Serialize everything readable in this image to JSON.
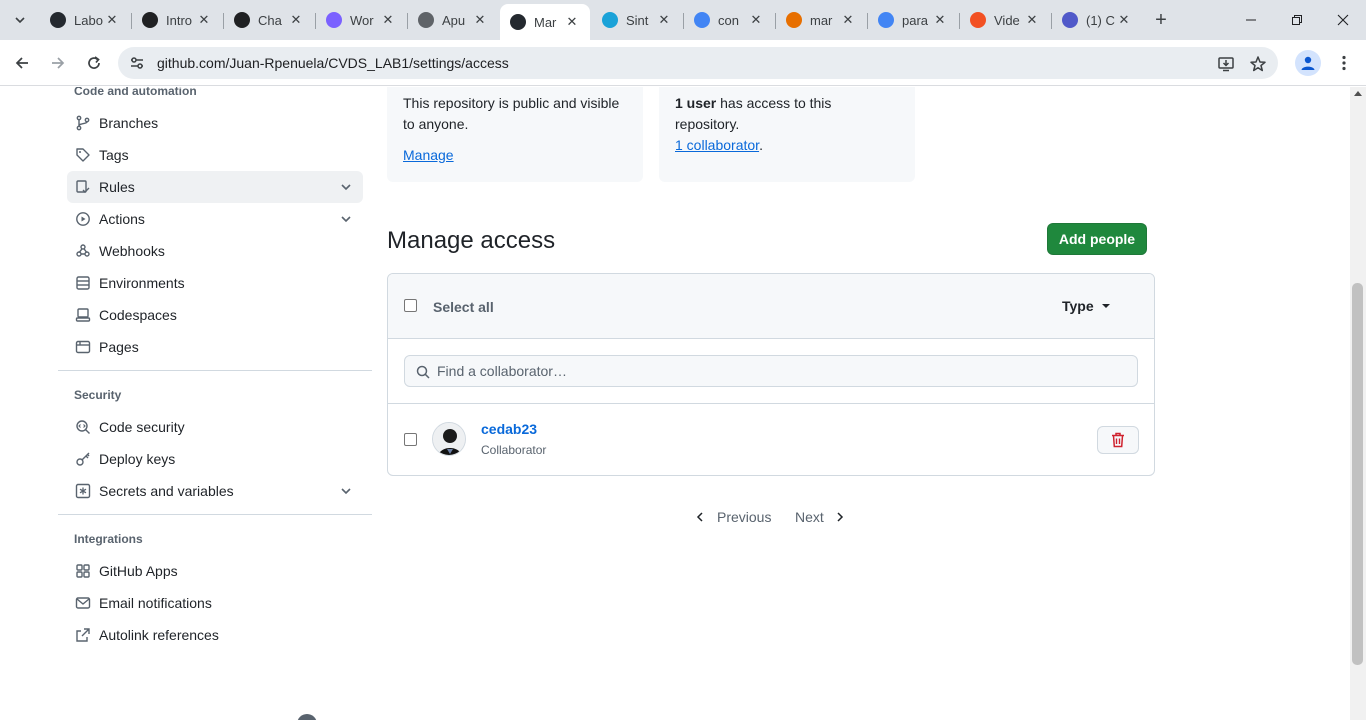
{
  "browser": {
    "tabs": [
      {
        "title": "Labo",
        "favicon": "github-icon",
        "color": "#24292f"
      },
      {
        "title": "Intro",
        "favicon": "openai-icon",
        "color": "#202123"
      },
      {
        "title": "Cha",
        "favicon": "openai-icon",
        "color": "#202123"
      },
      {
        "title": "Wor",
        "favicon": "copilot-icon",
        "color": "#7b61ff"
      },
      {
        "title": "Apu",
        "favicon": "globe-icon",
        "color": "#5f6368"
      },
      {
        "title": "Mar",
        "favicon": "github-icon",
        "color": "#24292f",
        "active": true
      },
      {
        "title": "Sint",
        "favicon": "m-icon",
        "color": "#1aa2d8"
      },
      {
        "title": "con",
        "favicon": "google-icon",
        "color": "#4285f4"
      },
      {
        "title": "mar",
        "favicon": "java-icon",
        "color": "#e76f00"
      },
      {
        "title": "para",
        "favicon": "google-icon",
        "color": "#4285f4"
      },
      {
        "title": "Vide",
        "favicon": "microsoft-icon",
        "color": "#f25022"
      },
      {
        "title": "(1) C",
        "favicon": "teams-icon",
        "color": "#5059c9"
      }
    ],
    "url": "github.com/Juan-Rpenuela/CVDS_LAB1/settings/access"
  },
  "sidebar": {
    "code_heading": "Code and automation",
    "code_items": [
      {
        "label": "Branches",
        "icon": "branch-icon"
      },
      {
        "label": "Tags",
        "icon": "tag-icon"
      },
      {
        "label": "Rules",
        "icon": "rules-icon",
        "expandable": true,
        "active": true
      },
      {
        "label": "Actions",
        "icon": "play-icon",
        "expandable": true
      },
      {
        "label": "Webhooks",
        "icon": "webhook-icon"
      },
      {
        "label": "Environments",
        "icon": "server-icon"
      },
      {
        "label": "Codespaces",
        "icon": "codespaces-icon"
      },
      {
        "label": "Pages",
        "icon": "browser-icon"
      }
    ],
    "security_heading": "Security",
    "security_items": [
      {
        "label": "Code security",
        "icon": "codescan-icon"
      },
      {
        "label": "Deploy keys",
        "icon": "key-icon"
      },
      {
        "label": "Secrets and variables",
        "icon": "asterisk-icon",
        "expandable": true
      }
    ],
    "integrations_heading": "Integrations",
    "integration_items": [
      {
        "label": "GitHub Apps",
        "icon": "apps-icon"
      },
      {
        "label": "Email notifications",
        "icon": "mail-icon"
      },
      {
        "label": "Autolink references",
        "icon": "link-external-icon"
      }
    ]
  },
  "visibility_card": {
    "text": "This repository is public and visible to anyone.",
    "manage_link": "Manage"
  },
  "access_card": {
    "count_bold": "1 user",
    "count_rest": " has access to this repository.",
    "collaborator_link": "1 collaborator",
    "period": "."
  },
  "manage_access": {
    "title": "Manage access",
    "add_button": "Add people",
    "select_all": "Select all",
    "type_filter": "Type",
    "search_placeholder": "Find a collaborator…",
    "members": [
      {
        "username": "cedab23",
        "role": "Collaborator"
      }
    ]
  },
  "pagination": {
    "previous": "Previous",
    "next": "Next"
  },
  "colors": {
    "primary_button": "#1f883d",
    "link": "#0969da",
    "danger": "#cf222e"
  }
}
